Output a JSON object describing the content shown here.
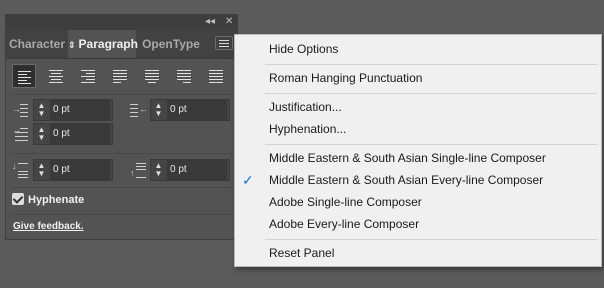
{
  "tabs": [
    {
      "label": "Character"
    },
    {
      "label": "Paragraph"
    },
    {
      "label": "OpenType"
    }
  ],
  "titlebar": {
    "collapse_icon": "double-chevron-icon",
    "close_icon": "close-icon"
  },
  "fields": {
    "left_indent": "0 pt",
    "right_indent": "0 pt",
    "first_line_indent": "0 pt",
    "space_before": "0 pt",
    "space_after": "0 pt"
  },
  "hyphenate": {
    "label": "Hyphenate",
    "checked": true
  },
  "feedback": {
    "label": "Give feedback."
  },
  "menu": {
    "items": [
      {
        "label": "Hide Options"
      },
      {
        "label": "Roman Hanging Punctuation"
      },
      {
        "label": "Justification..."
      },
      {
        "label": "Hyphenation..."
      },
      {
        "label": "Middle Eastern & South Asian Single-line Composer"
      },
      {
        "label": "Middle Eastern & South Asian Every-line Composer",
        "checked": true
      },
      {
        "label": "Adobe Single-line Composer"
      },
      {
        "label": "Adobe Every-line Composer"
      },
      {
        "label": "Reset Panel"
      }
    ]
  },
  "colors": {
    "accent": "#1473e6",
    "panel": "#535353",
    "menu_bg": "#f0f0f0"
  }
}
